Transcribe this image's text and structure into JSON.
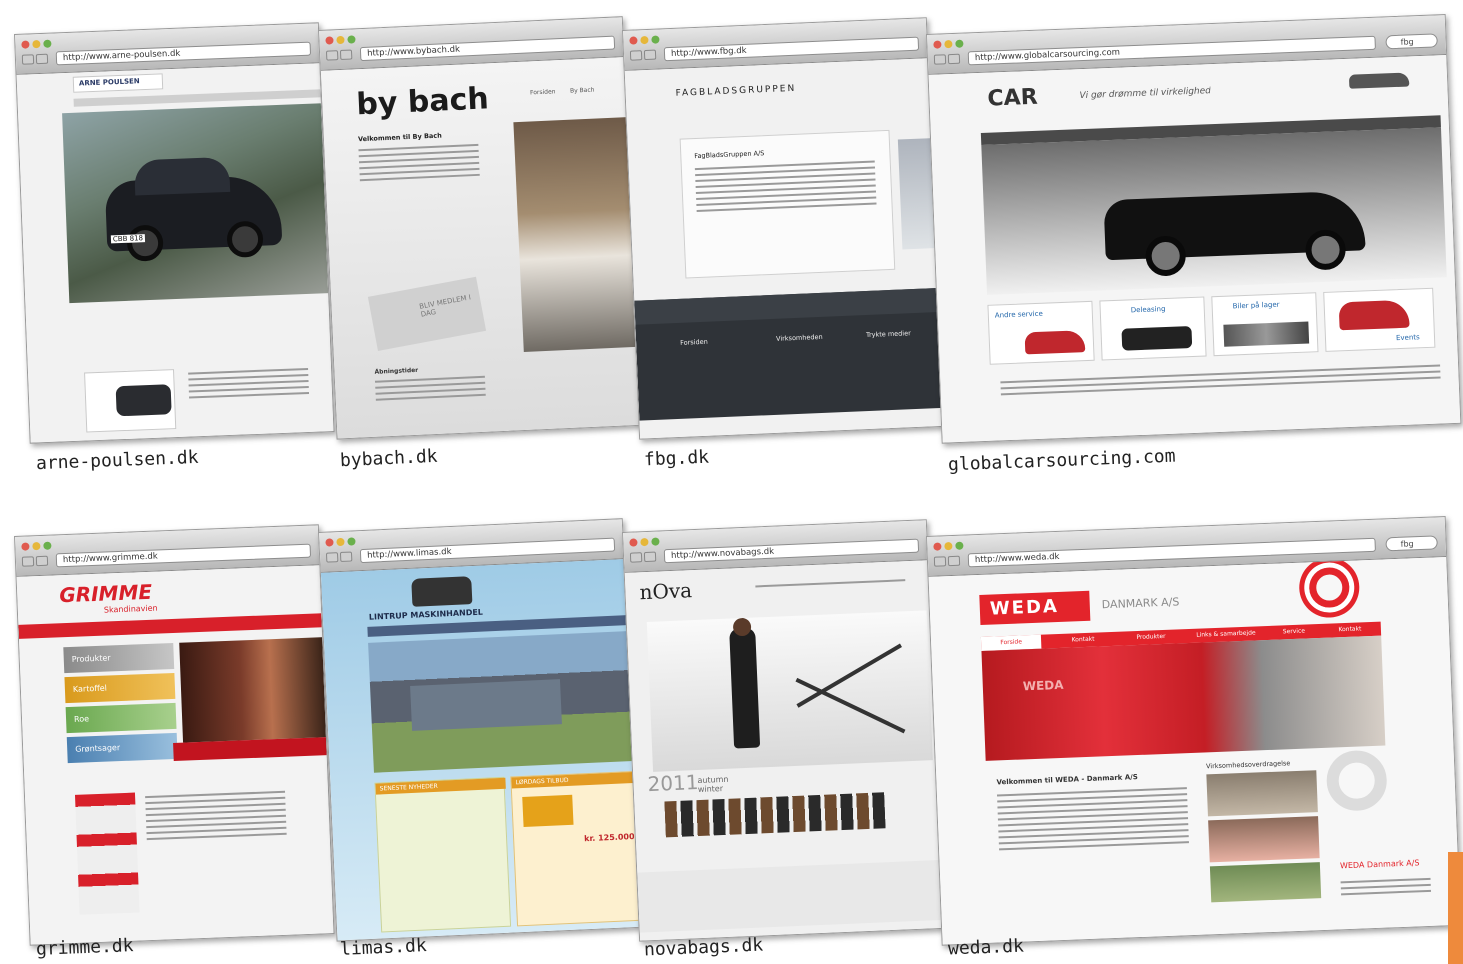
{
  "browser": {
    "search_field": "fbg"
  },
  "panels": [
    {
      "url": "http://www.arne-poulsen.dk",
      "caption": "arne-poulsen.dk",
      "site": {
        "logo": "ARNE POULSEN",
        "plate": "CBB 818"
      }
    },
    {
      "url": "http://www.bybach.dk",
      "caption": "bybach.dk",
      "site": {
        "logo": "by bach",
        "welcome": "Velkommen til By Bach",
        "hours_title": "Åbningstider",
        "nav_items": [
          "Forsiden",
          "By Bach"
        ],
        "badge": "BLIV MEDLEM I DAG"
      }
    },
    {
      "url": "http://www.fbg.dk",
      "caption": "fbg.dk",
      "site": {
        "logo": "FAGBLADSGRUPPEN",
        "box_title": "FagBladsGruppen A/S",
        "footer_cols": [
          "Forsiden",
          "Virksomheden",
          "Trykte medier"
        ]
      }
    },
    {
      "url": "http://www.globalcarsourcing.com",
      "caption": "globalcarsourcing.com",
      "site": {
        "logo": "CAR",
        "tagline": "Vi gør drømme til virkelighed",
        "promos": [
          "Andre service",
          "Deleasing",
          "Biler på lager"
        ],
        "promo_right": "Events"
      }
    },
    {
      "url": "http://www.grimme.dk",
      "caption": "grimme.dk",
      "site": {
        "logo": "GRIMME",
        "sublogo": "Skandinavien",
        "menu": [
          "Produkter",
          "Kartoffel",
          "Roe",
          "Grøntsager"
        ]
      }
    },
    {
      "url": "http://www.limas.dk",
      "caption": "limas.dk",
      "site": {
        "logo": "LINTRUP MASKINHANDEL",
        "box_left": "SENESTE NYHEDER",
        "box_right": "LØRDAGS TILBUD",
        "price": "kr. 125.000"
      }
    },
    {
      "url": "http://www.novabags.dk",
      "caption": "novabags.dk",
      "site": {
        "logo": "nOva",
        "collection_year": "2011",
        "collection_name": "autumn winter"
      }
    },
    {
      "url": "http://www.weda.dk",
      "caption": "weda.dk",
      "site": {
        "logo": "WEDA",
        "company": "DANMARK A/S",
        "tank_label": "WEDA",
        "welcome": "Velkommen til WEDA - Danmark A/S",
        "side_title": "Virksomhedsoverdragelse",
        "footer_brand": "WEDA Danmark A/S",
        "tabs": [
          "Forside",
          "Kontakt",
          "Produkter",
          "Links & samarbejde",
          "Service",
          "Kontakt"
        ]
      }
    }
  ],
  "colors": {
    "grimme_red": "#d8202a",
    "weda_red": "#e3242b",
    "fbg_dark": "#2f3338",
    "accent_tab": "#ee8a3c"
  }
}
